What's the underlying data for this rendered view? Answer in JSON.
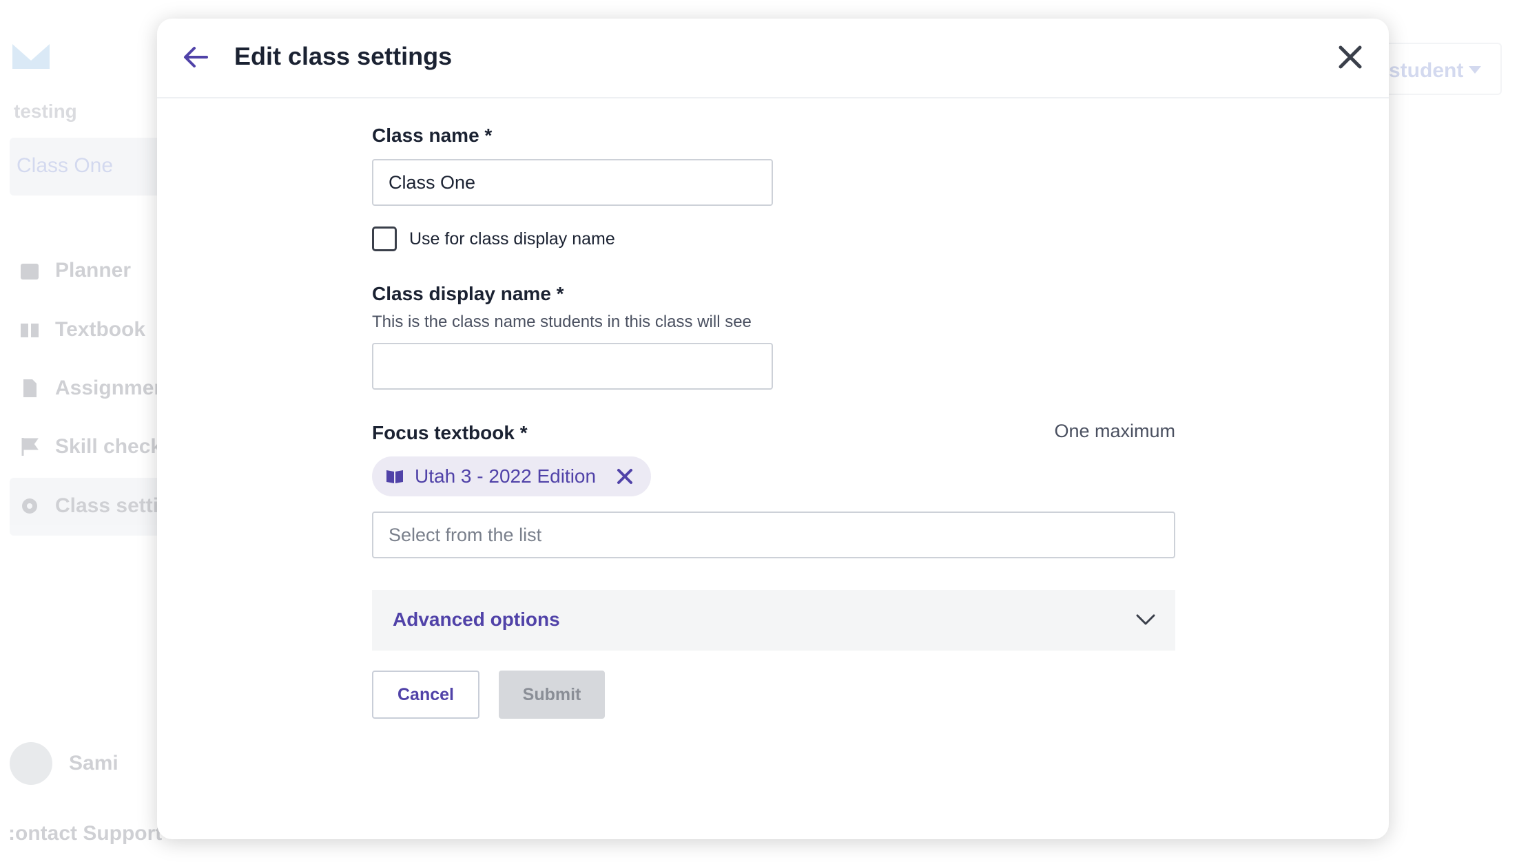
{
  "background": {
    "workspace_name": "testing",
    "class_name": "Class One",
    "nav": [
      {
        "label": "Planner",
        "icon": "calendar-icon"
      },
      {
        "label": "Textbook",
        "icon": "book-icon"
      },
      {
        "label": "Assignment",
        "icon": "document-icon"
      },
      {
        "label": "Skill check-",
        "icon": "flag-icon"
      },
      {
        "label": "Class settin",
        "icon": "gear-icon"
      }
    ],
    "user_name": "Sami",
    "support_label": ":ontact Support",
    "top_selector_label": "student"
  },
  "modal": {
    "title": "Edit class settings",
    "back_icon": "arrow-left-icon",
    "close_icon": "close-icon",
    "class_name": {
      "label": "Class name *",
      "value": "Class One"
    },
    "use_display_checkbox": {
      "label": "Use for class display name",
      "checked": false
    },
    "display_name": {
      "label": "Class display name *",
      "help": "This is the class name students in this class will see",
      "value": "",
      "placeholder": ""
    },
    "focus_textbook": {
      "label": "Focus textbook *",
      "limit_note": "One maximum",
      "selected": [
        {
          "label": "Utah 3 - 2022 Edition",
          "icon": "book-open-icon"
        }
      ],
      "placeholder": "Select from the list"
    },
    "advanced_options": {
      "label": "Advanced options",
      "icon": "chevron-down-icon"
    },
    "buttons": {
      "cancel": "Cancel",
      "submit": "Submit"
    }
  },
  "colors": {
    "accent": "#5042a8",
    "text": "#1b2232",
    "disabled_button": "#d6d8dc"
  }
}
